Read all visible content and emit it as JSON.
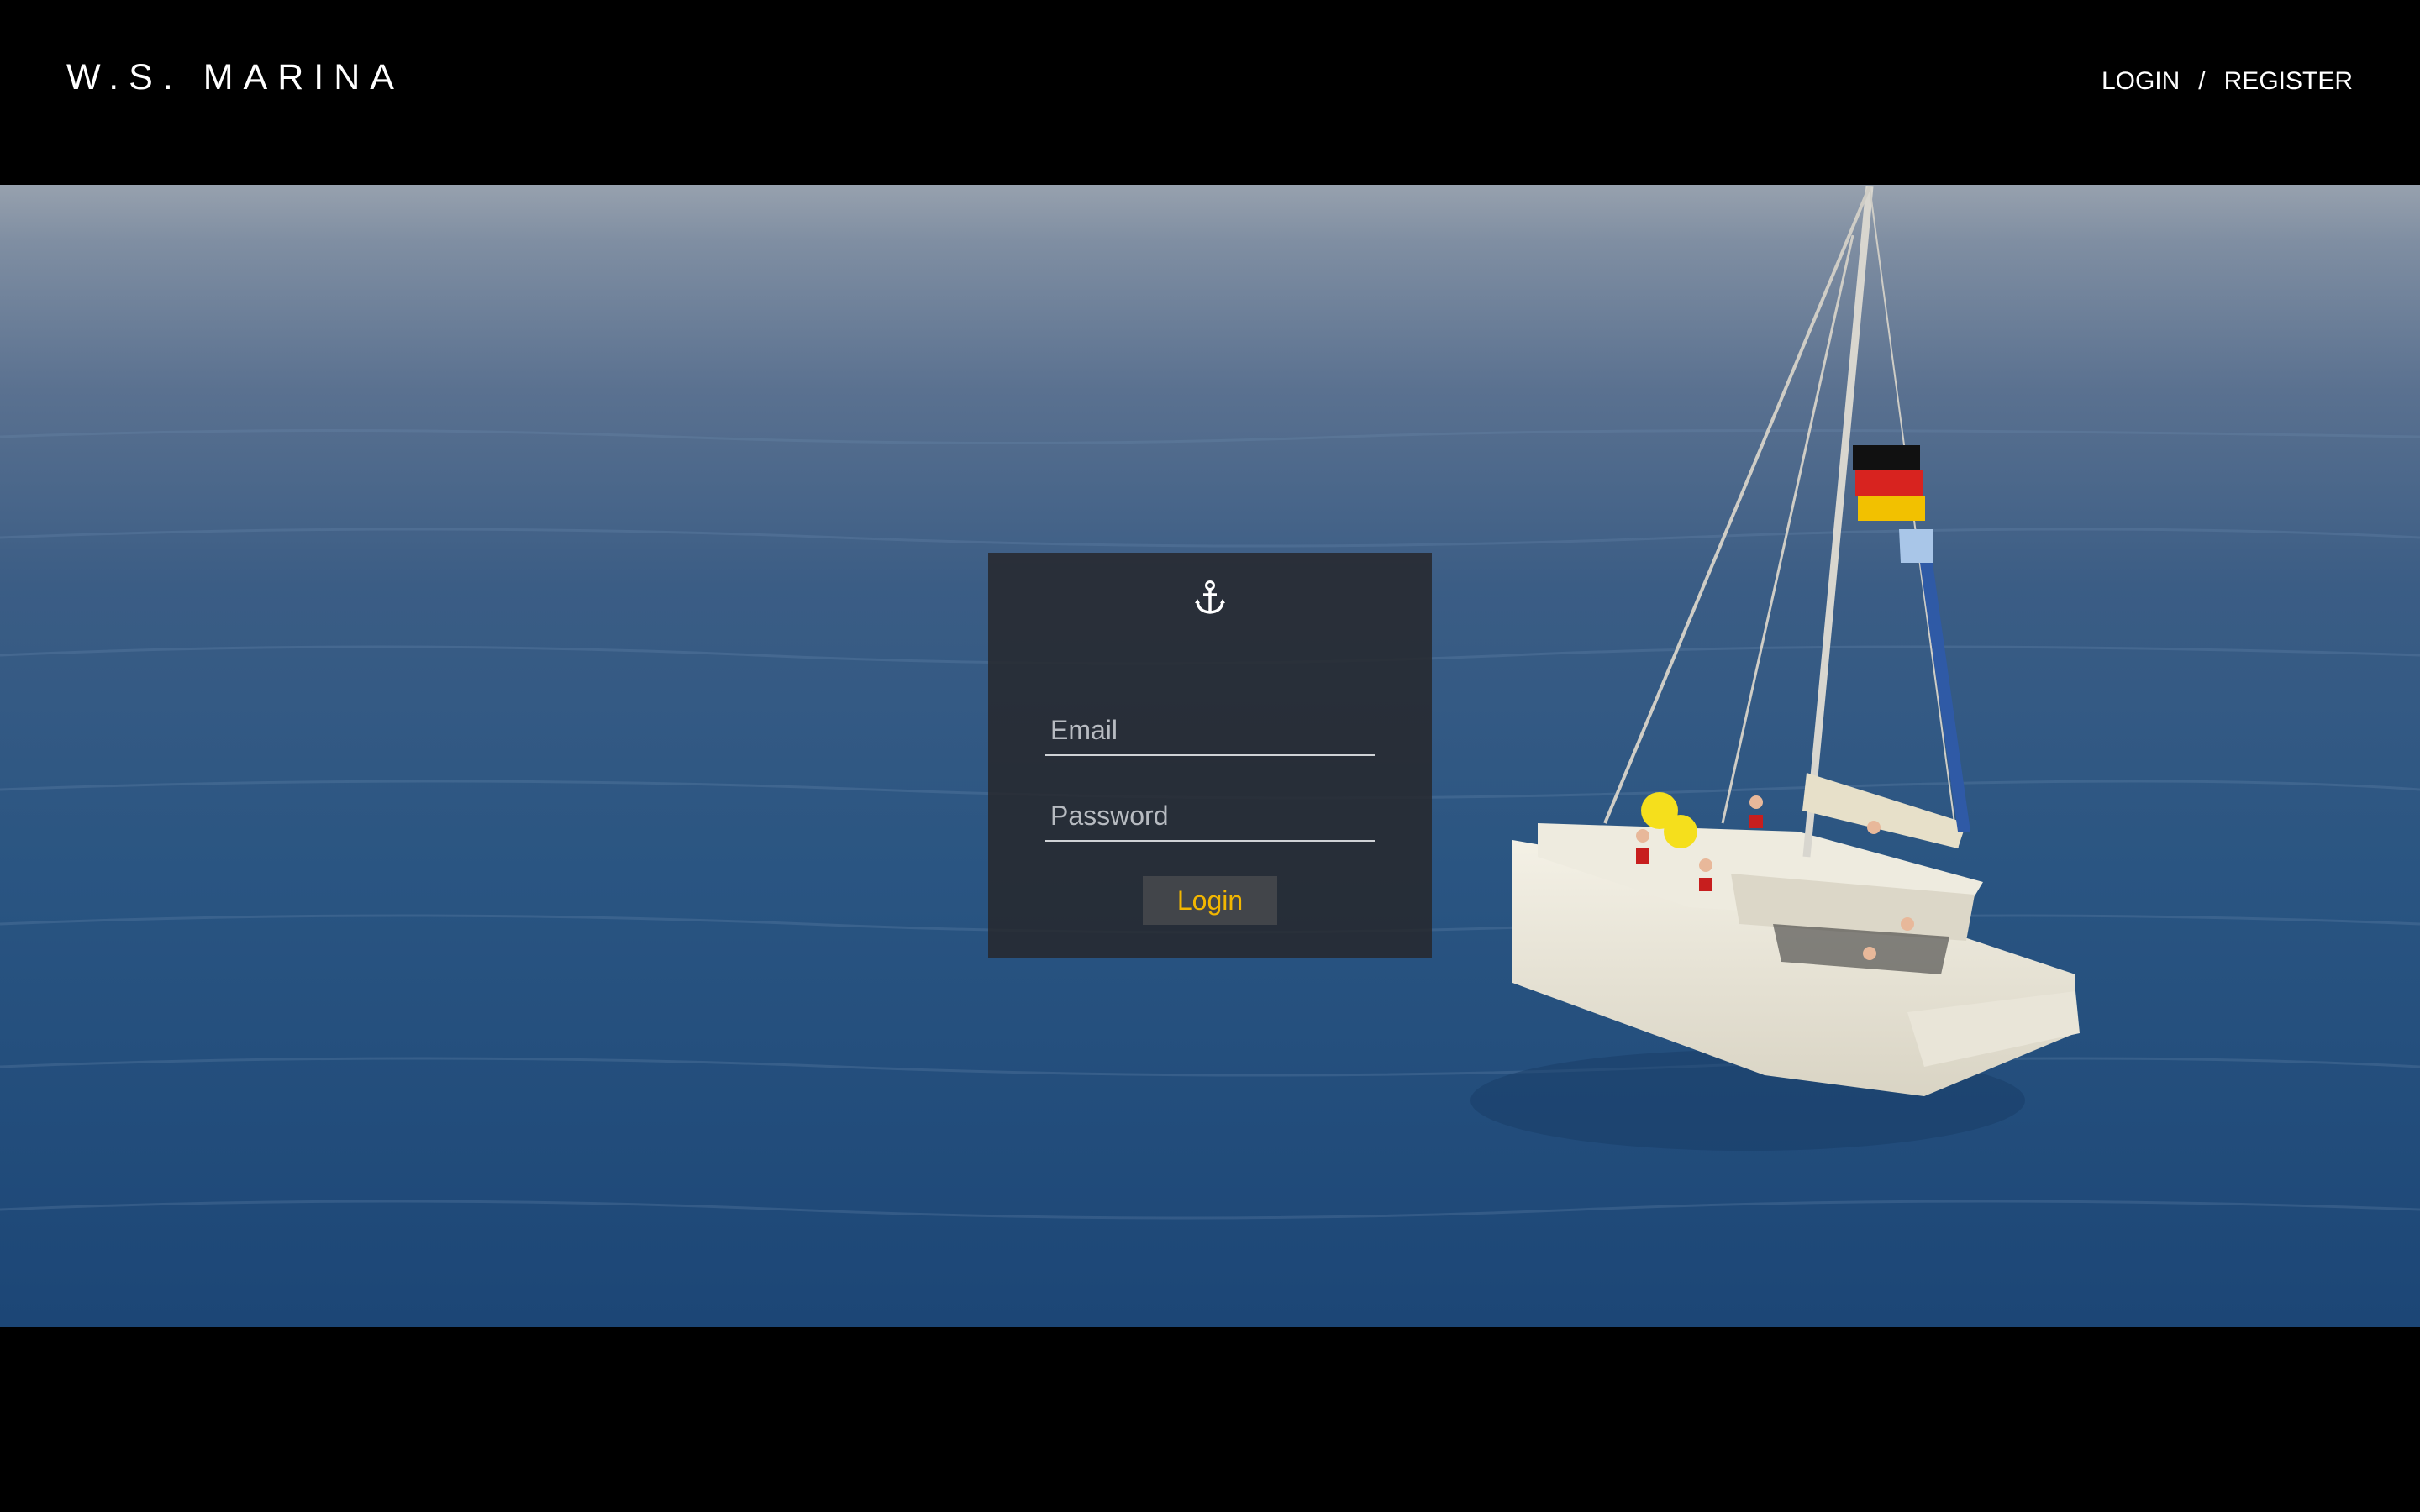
{
  "header": {
    "brand": "W.S. MARINA",
    "login_link": "LOGIN",
    "separator": "/",
    "register_link": "REGISTER"
  },
  "login_form": {
    "icon": "anchor-icon",
    "email_placeholder": "Email",
    "password_placeholder": "Password",
    "submit_label": "Login"
  },
  "colors": {
    "background": "#000000",
    "panel": "#26282c",
    "accent": "#f2b600",
    "text": "#ffffff"
  }
}
